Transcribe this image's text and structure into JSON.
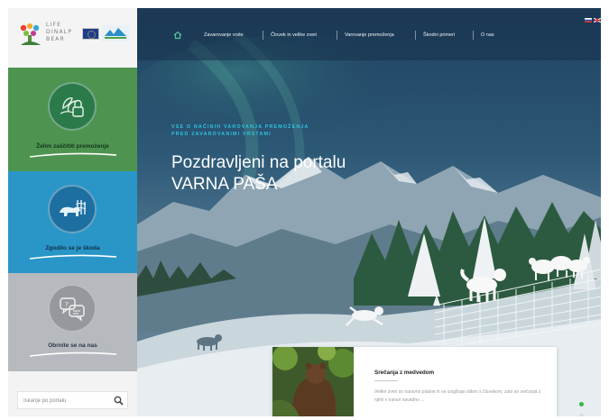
{
  "sidebar": {
    "logo_lines": [
      "LIFE",
      "DINALP",
      "BEAR"
    ],
    "tiles": [
      {
        "label": "Želim zaščititi premoženje",
        "color": "#4e9450",
        "icon": "lock-plant-icon"
      },
      {
        "label": "Zgodilo se je škoda",
        "color": "#2a96c8",
        "icon": "bear-fence-icon"
      },
      {
        "label": "Obrnite se na nas",
        "color": "#b6b9bd",
        "icon": "chat-bubbles-icon"
      }
    ],
    "search": {
      "placeholder": "Iskanje po portalu"
    }
  },
  "topnav": {
    "items": [
      "Zavarovanje vrste",
      "Človek in velike zveri",
      "Varovanje premoženja",
      "Škodni primeri",
      "O nas"
    ]
  },
  "hero": {
    "kicker": [
      "VSE O NAČINIH VAROVANJA PREMOŽENJA",
      "PRED ZAVAROVANIMI VRSTAMI"
    ],
    "title": [
      "Pozdravljeni na portalu",
      "VARNA PAŠA"
    ]
  },
  "news": {
    "title": "Srečanja z medvedom",
    "body": "Velike zveri so naravno plašne in se izogibajo stikov s človekom, zato so srečanja z njimi v naravi navadno ..."
  },
  "colors": {
    "accent": "#2fc4de",
    "hero_bg": "#2a4a62",
    "active_dot": "#3bb34a"
  }
}
